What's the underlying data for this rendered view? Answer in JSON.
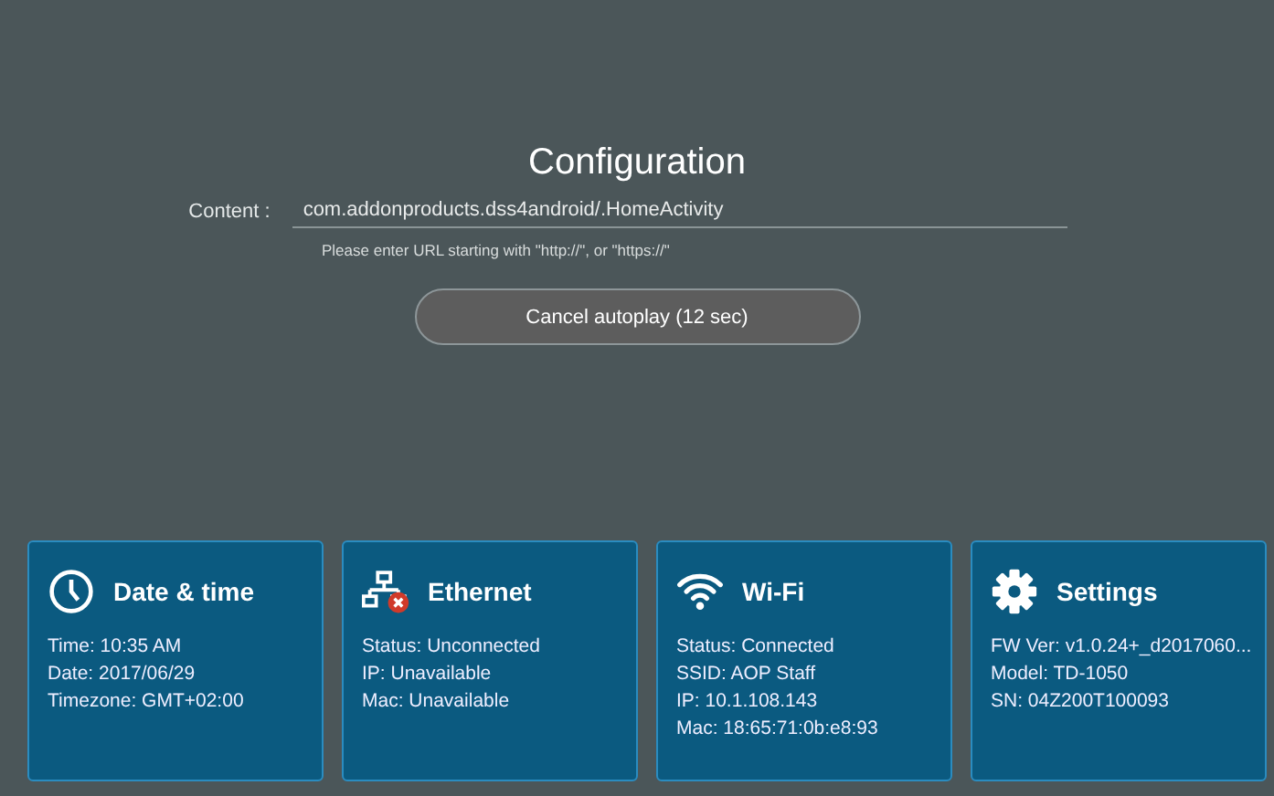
{
  "title": "Configuration",
  "content": {
    "label": "Content :",
    "value": "com.addonproducts.dss4android/.HomeActivity",
    "hint": "Please enter URL starting with \"http://\", or \"https://\""
  },
  "cancel_button": "Cancel autoplay (12 sec)",
  "cards": [
    {
      "kind": "clock",
      "title": "Date & time",
      "lines": [
        "Time: 10:35 AM",
        "Date: 2017/06/29",
        "Timezone: GMT+02:00"
      ]
    },
    {
      "kind": "network",
      "title": "Ethernet",
      "error": true,
      "lines": [
        "Status: Unconnected",
        "IP: Unavailable",
        "Mac: Unavailable"
      ]
    },
    {
      "kind": "wifi",
      "title": "Wi-Fi",
      "lines": [
        "Status: Connected",
        "SSID: AOP Staff",
        "IP: 10.1.108.143",
        "Mac: 18:65:71:0b:e8:93"
      ]
    },
    {
      "kind": "gear",
      "title": "Settings",
      "lines": [
        "FW Ver: v1.0.24+_d2017060...",
        "Model: TD-1050",
        "SN: 04Z200T100093"
      ]
    }
  ]
}
